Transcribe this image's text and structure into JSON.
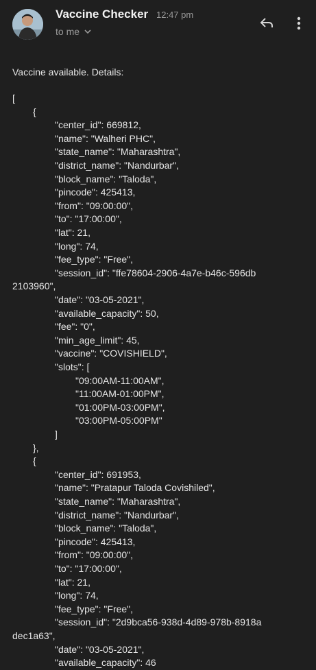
{
  "header": {
    "sender": "Vaccine Checker",
    "time": "12:47 pm",
    "recipient": "to me"
  },
  "icons": {
    "avatar": "avatar",
    "recipient_toggle": "chevron-down-icon",
    "reply": "reply-icon",
    "more": "more-vertical-icon"
  },
  "email": {
    "intro": "Vaccine available. Details:",
    "lines": [
      "[",
      "{",
      "\"center_id\": 669812,",
      "\"name\": \"Walheri PHC\",",
      "\"state_name\": \"Maharashtra\",",
      "\"district_name\": \"Nandurbar\",",
      "\"block_name\": \"Taloda\",",
      "\"pincode\": 425413,",
      "\"from\": \"09:00:00\",",
      "\"to\": \"17:00:00\",",
      "\"lat\": 21,",
      "\"long\": 74,",
      "\"fee_type\": \"Free\",",
      "\"session_id\": \"ffe78604-2906-4a7e-b46c-596db",
      "2103960\",",
      "\"date\": \"03-05-2021\",",
      "\"available_capacity\": 50,",
      "\"fee\": \"0\",",
      "\"min_age_limit\": 45,",
      "\"vaccine\": \"COVISHIELD\",",
      "\"slots\": [",
      "\"09:00AM-11:00AM\",",
      "\"11:00AM-01:00PM\",",
      "\"01:00PM-03:00PM\",",
      "\"03:00PM-05:00PM\"",
      "]",
      "},",
      "{",
      "\"center_id\": 691953,",
      "\"name\": \"Pratapur Taloda Covishiled\",",
      "\"state_name\": \"Maharashtra\",",
      "\"district_name\": \"Nandurbar\",",
      "\"block_name\": \"Taloda\",",
      "\"pincode\": 425413,",
      "\"from\": \"09:00:00\",",
      "\"to\": \"17:00:00\",",
      "\"lat\": 21,",
      "\"long\": 74,",
      "\"fee_type\": \"Free\",",
      "\"session_id\": \"2d9bca56-938d-4d89-978b-8918a",
      "dec1a63\",",
      "\"date\": \"03-05-2021\",",
      "\"available_capacity\": 46"
    ]
  }
}
